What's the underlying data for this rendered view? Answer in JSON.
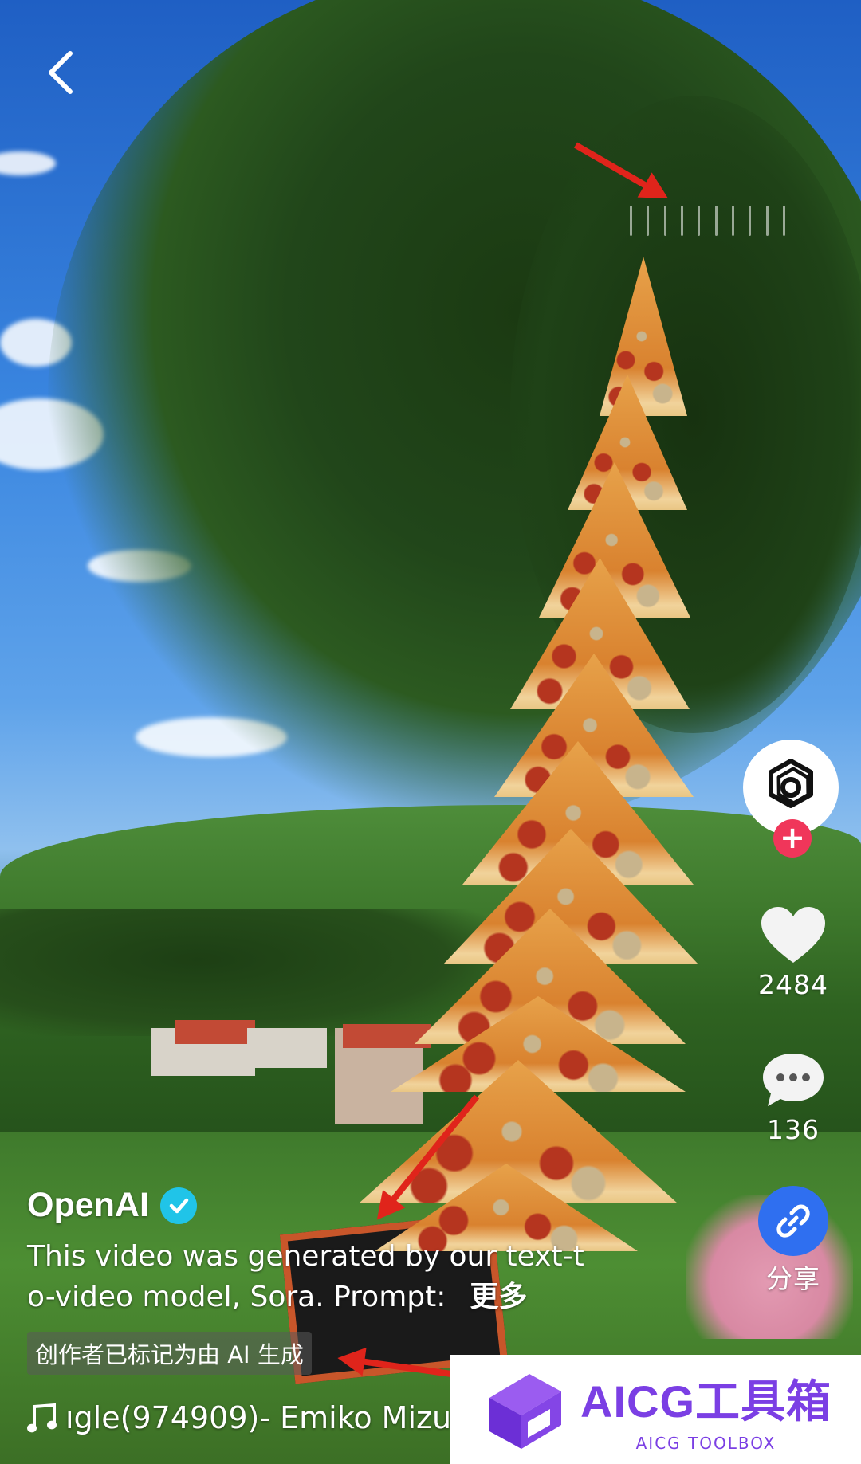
{
  "top": {
    "back_icon": "chevron-left-icon"
  },
  "author": {
    "name": "OpenAI",
    "verified_icon": "checkmark-badge-icon"
  },
  "description": {
    "line1": "This video was generated by our text-t",
    "line2": "o-video model, Sora.  Prompt:",
    "more_label": "更多"
  },
  "ai_label": "创作者已标记为由 AI 生成",
  "music": {
    "icon": "music-note-icon",
    "text": "ıgle(974909)- Emiko Mizu"
  },
  "rail": {
    "avatar_icon": "openai-logo-icon",
    "follow_label": "+",
    "like_count": "2484",
    "comment_count": "136",
    "share_label": "分享"
  },
  "watermark": {
    "title": "AICG工具箱",
    "subtitle": "AICG TOOLBOX"
  },
  "colors": {
    "follow_red": "#f0365a",
    "share_blue": "#2f6ff0",
    "verified_cyan": "#20c4e8",
    "arrow_red": "#e0241b",
    "watermark_purple": "#7b3fe4"
  }
}
